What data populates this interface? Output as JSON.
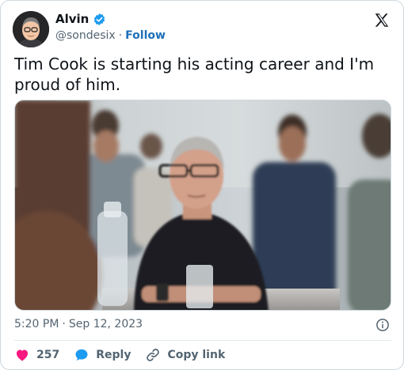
{
  "author": {
    "name": "Alvin",
    "handle": "@sondesix",
    "separator": "·",
    "follow_label": "Follow",
    "verified": true
  },
  "tweet": {
    "text": "Tim Cook is starting his acting career and I'm proud of him."
  },
  "meta": {
    "time": "5:20 PM",
    "separator": "·",
    "date": "Sep 12, 2023"
  },
  "actions": {
    "like_count": "257",
    "reply_label": "Reply",
    "copy_link_label": "Copy link"
  },
  "colors": {
    "like": "#f91880",
    "reply": "#1d9bf0",
    "link": "#1d6fb8",
    "muted": "#536471"
  },
  "icons": [
    "verified-badge-icon",
    "x-logo-icon",
    "info-icon",
    "heart-icon",
    "reply-bubble-icon",
    "link-icon"
  ]
}
